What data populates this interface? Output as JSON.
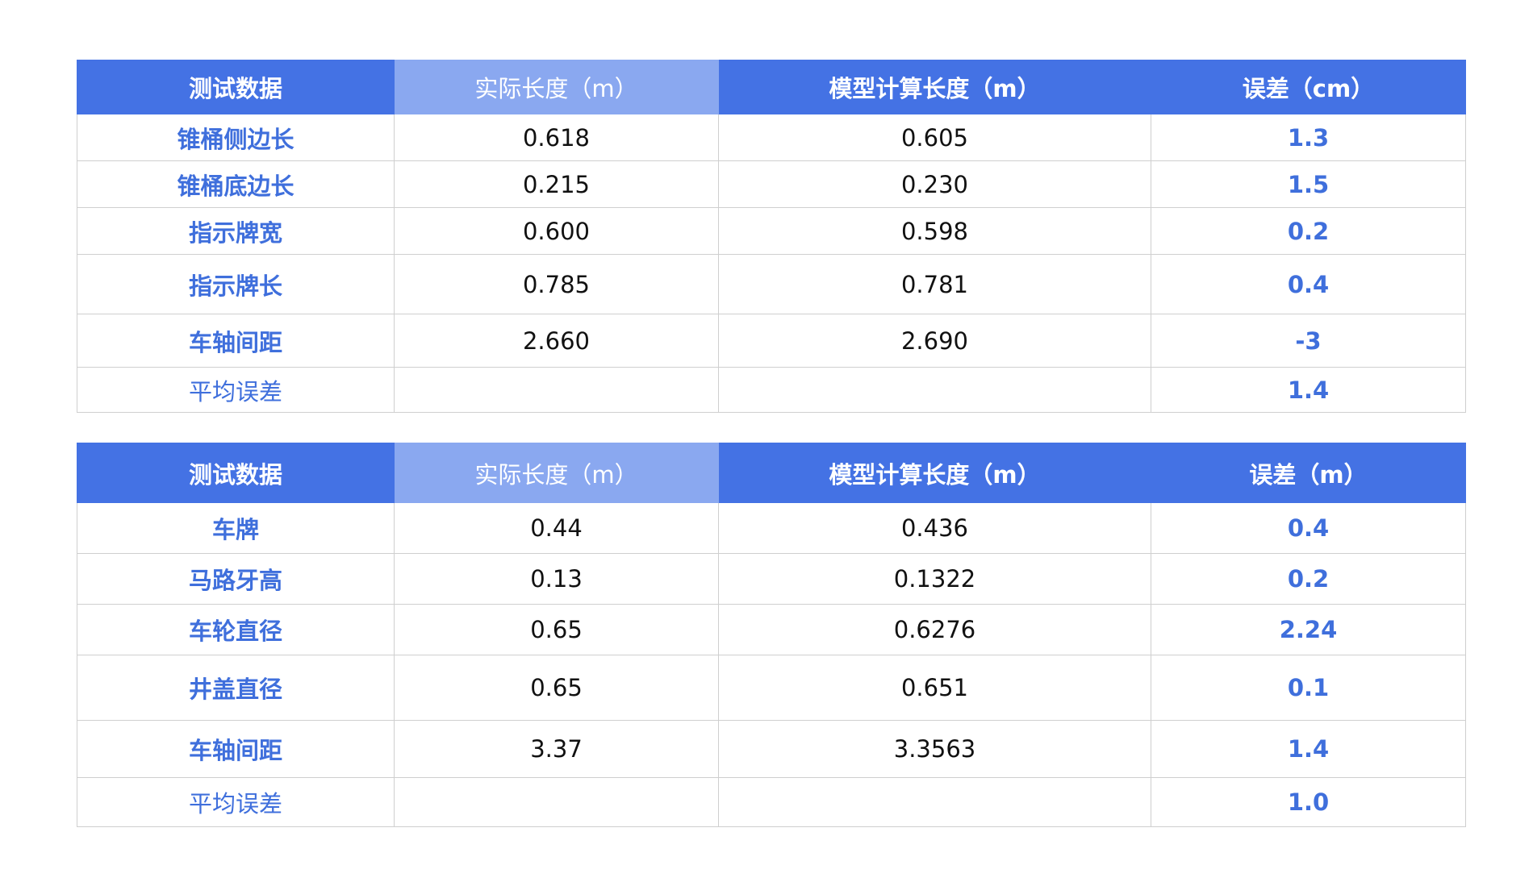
{
  "table1": {
    "headers": [
      "测试数据",
      "实际长度（m）",
      "模型计算长度（m）",
      "误差（cm）"
    ],
    "rows": [
      {
        "label": "锥桶侧边长",
        "actual": "0.618",
        "model": "0.605",
        "error": "1.3"
      },
      {
        "label": "锥桶底边长",
        "actual": "0.215",
        "model": "0.230",
        "error": "1.5"
      },
      {
        "label": "指示牌宽",
        "actual": "0.600",
        "model": "0.598",
        "error": "0.2"
      },
      {
        "label": "指示牌长",
        "actual": "0.785",
        "model": "0.781",
        "error": "0.4"
      },
      {
        "label": "车轴间距",
        "actual": "2.660",
        "model": "2.690",
        "error": "-3"
      }
    ],
    "summary": {
      "label": "平均误差",
      "actual": "",
      "model": "",
      "error": "1.4"
    }
  },
  "table2": {
    "headers": [
      "测试数据",
      "实际长度（m）",
      "模型计算长度（m）",
      "误差（m）"
    ],
    "rows": [
      {
        "label": "车牌",
        "actual": "0.44",
        "model": "0.436",
        "error": "0.4"
      },
      {
        "label": "马路牙高",
        "actual": "0.13",
        "model": "0.1322",
        "error": "0.2"
      },
      {
        "label": "车轮直径",
        "actual": "0.65",
        "model": "0.6276",
        "error": "2.24"
      },
      {
        "label": "井盖直径",
        "actual": "0.65",
        "model": "0.651",
        "error": "0.1"
      },
      {
        "label": "车轴间距",
        "actual": "3.37",
        "model": "3.3563",
        "error": "1.4"
      }
    ],
    "summary": {
      "label": "平均误差",
      "actual": "",
      "model": "",
      "error": "1.0"
    }
  },
  "colors": {
    "header_blue": "#4472e4",
    "header_light_blue": "#8aa8f0",
    "label_blue": "#3f6fdc",
    "grid_gray": "#cfcfcf"
  }
}
